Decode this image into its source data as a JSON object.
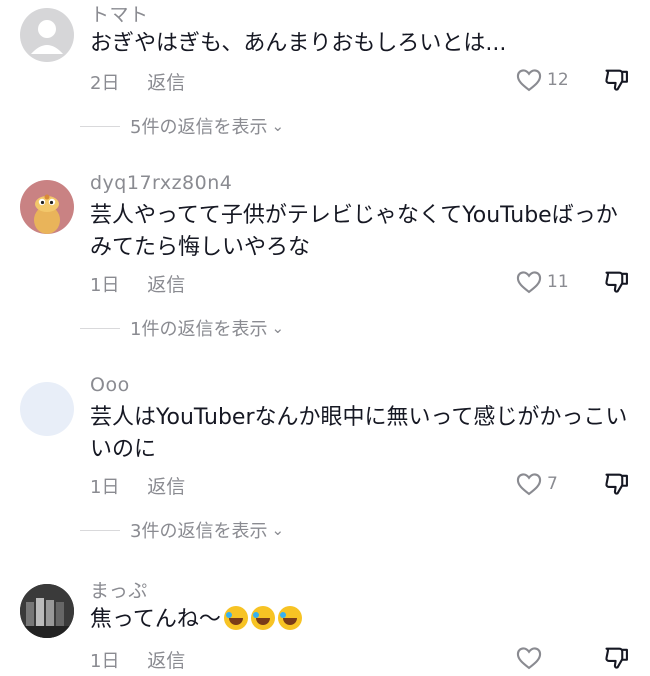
{
  "comments": [
    {
      "username": "トマト",
      "text": "おぎやはぎも、あんまりおもしろいとは...",
      "date": "2日",
      "reply_label": "返信",
      "likes": "12",
      "view_replies": "5件の返信を表示"
    },
    {
      "username": "dyq17rxz80n4",
      "text": "芸人やってて子供がテレビじゃなくてYouTubeばっかみてたら悔しいやろな",
      "date": "1日",
      "reply_label": "返信",
      "likes": "11",
      "view_replies": "1件の返信を表示"
    },
    {
      "username": "Ooo",
      "text": "芸人はYouTuberなんか眼中に無いって感じがかっこいいのに",
      "date": "1日",
      "reply_label": "返信",
      "likes": "7",
      "view_replies": "3件の返信を表示"
    },
    {
      "username": "まっぷ",
      "text": "焦ってんね〜",
      "emoji": "rolling-on-floor-laughing x3",
      "date": "1日",
      "reply_label": "返信",
      "likes": ""
    }
  ],
  "colors": {
    "text": "#161823",
    "secondary": "#8a8b91"
  }
}
